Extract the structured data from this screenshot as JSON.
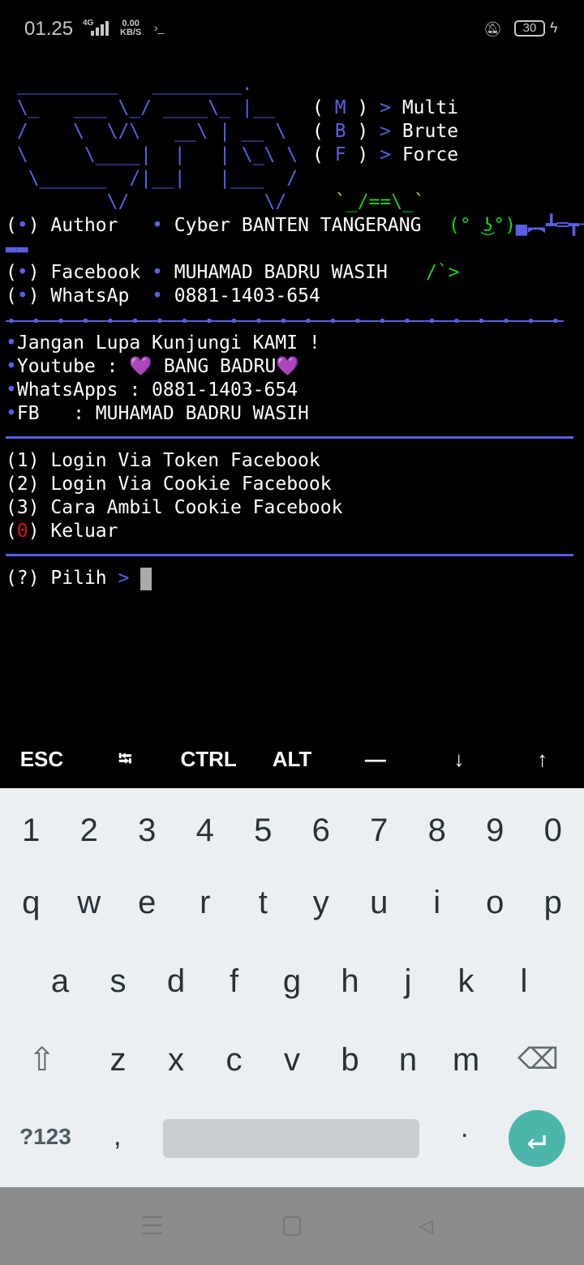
{
  "status": {
    "time": "01.25",
    "network": "4G",
    "speed_value": "0.00",
    "speed_unit": "KB/S",
    "battery": "30"
  },
  "banner": {
    "art": [
      " _________   ________.",
      " \\_   ___ \\_/ ____\\_ |__",
      " /    \\  \\/\\   __\\ | __ \\",
      " \\     \\____|  |   | \\_\\ \\",
      "  \\______  /|__|   |___  /",
      "         \\/            \\/"
    ],
    "modes": [
      {
        "letter": "M",
        "label": "Multi"
      },
      {
        "letter": "B",
        "label": "Brute"
      },
      {
        "letter": "F",
        "label": "Force"
      }
    ],
    "mascot_top": "_/==\\_",
    "mascot_face": "(° ͜ʖ°)",
    "gun": "▄︻┻═┳一",
    "gun_tail": "▬▬",
    "mascot_hand": "/`>"
  },
  "info": [
    {
      "label": "Author  ",
      "value": "Cyber BANTEN TANGERANG"
    },
    {
      "label": "Facebook",
      "value": "MUHAMAD BADRU WASIH"
    },
    {
      "label": "WhatsAp ",
      "value": "0881-1403-654"
    }
  ],
  "promo": [
    "Jangan Lupa Kunjungi KAMI !",
    "Youtube : 💜 BANG BADRU💜",
    "WhatsApps : 0881-1403-654",
    "FB   : MUHAMAD BADRU WASIH"
  ],
  "menu": [
    {
      "num": "1",
      "label": "Login Via Token Facebook"
    },
    {
      "num": "2",
      "label": "Login Via Cookie Facebook"
    },
    {
      "num": "3",
      "label": "Cara Ambil Cookie Facebook"
    },
    {
      "num": "0",
      "label": "Keluar"
    }
  ],
  "prompt": {
    "prefix": "(?)",
    "label": "Pilih",
    "arrow": ">"
  },
  "extra_keys": [
    "ESC",
    "⭾",
    "CTRL",
    "ALT",
    "—",
    "↓",
    "↑"
  ],
  "keyboard": {
    "row1": [
      "1",
      "2",
      "3",
      "4",
      "5",
      "6",
      "7",
      "8",
      "9",
      "0"
    ],
    "row2": [
      "q",
      "w",
      "e",
      "r",
      "t",
      "y",
      "u",
      "i",
      "o",
      "p"
    ],
    "row3": [
      "a",
      "s",
      "d",
      "f",
      "g",
      "h",
      "j",
      "k",
      "l"
    ],
    "row4": [
      "z",
      "x",
      "c",
      "v",
      "b",
      "n",
      "m"
    ],
    "symbols": "?123",
    "comma": ",",
    "period": "."
  },
  "colors": {
    "accent": "#5a5ee6",
    "green": "#19d31d",
    "red": "#e01010",
    "enter": "#4db6ac"
  }
}
